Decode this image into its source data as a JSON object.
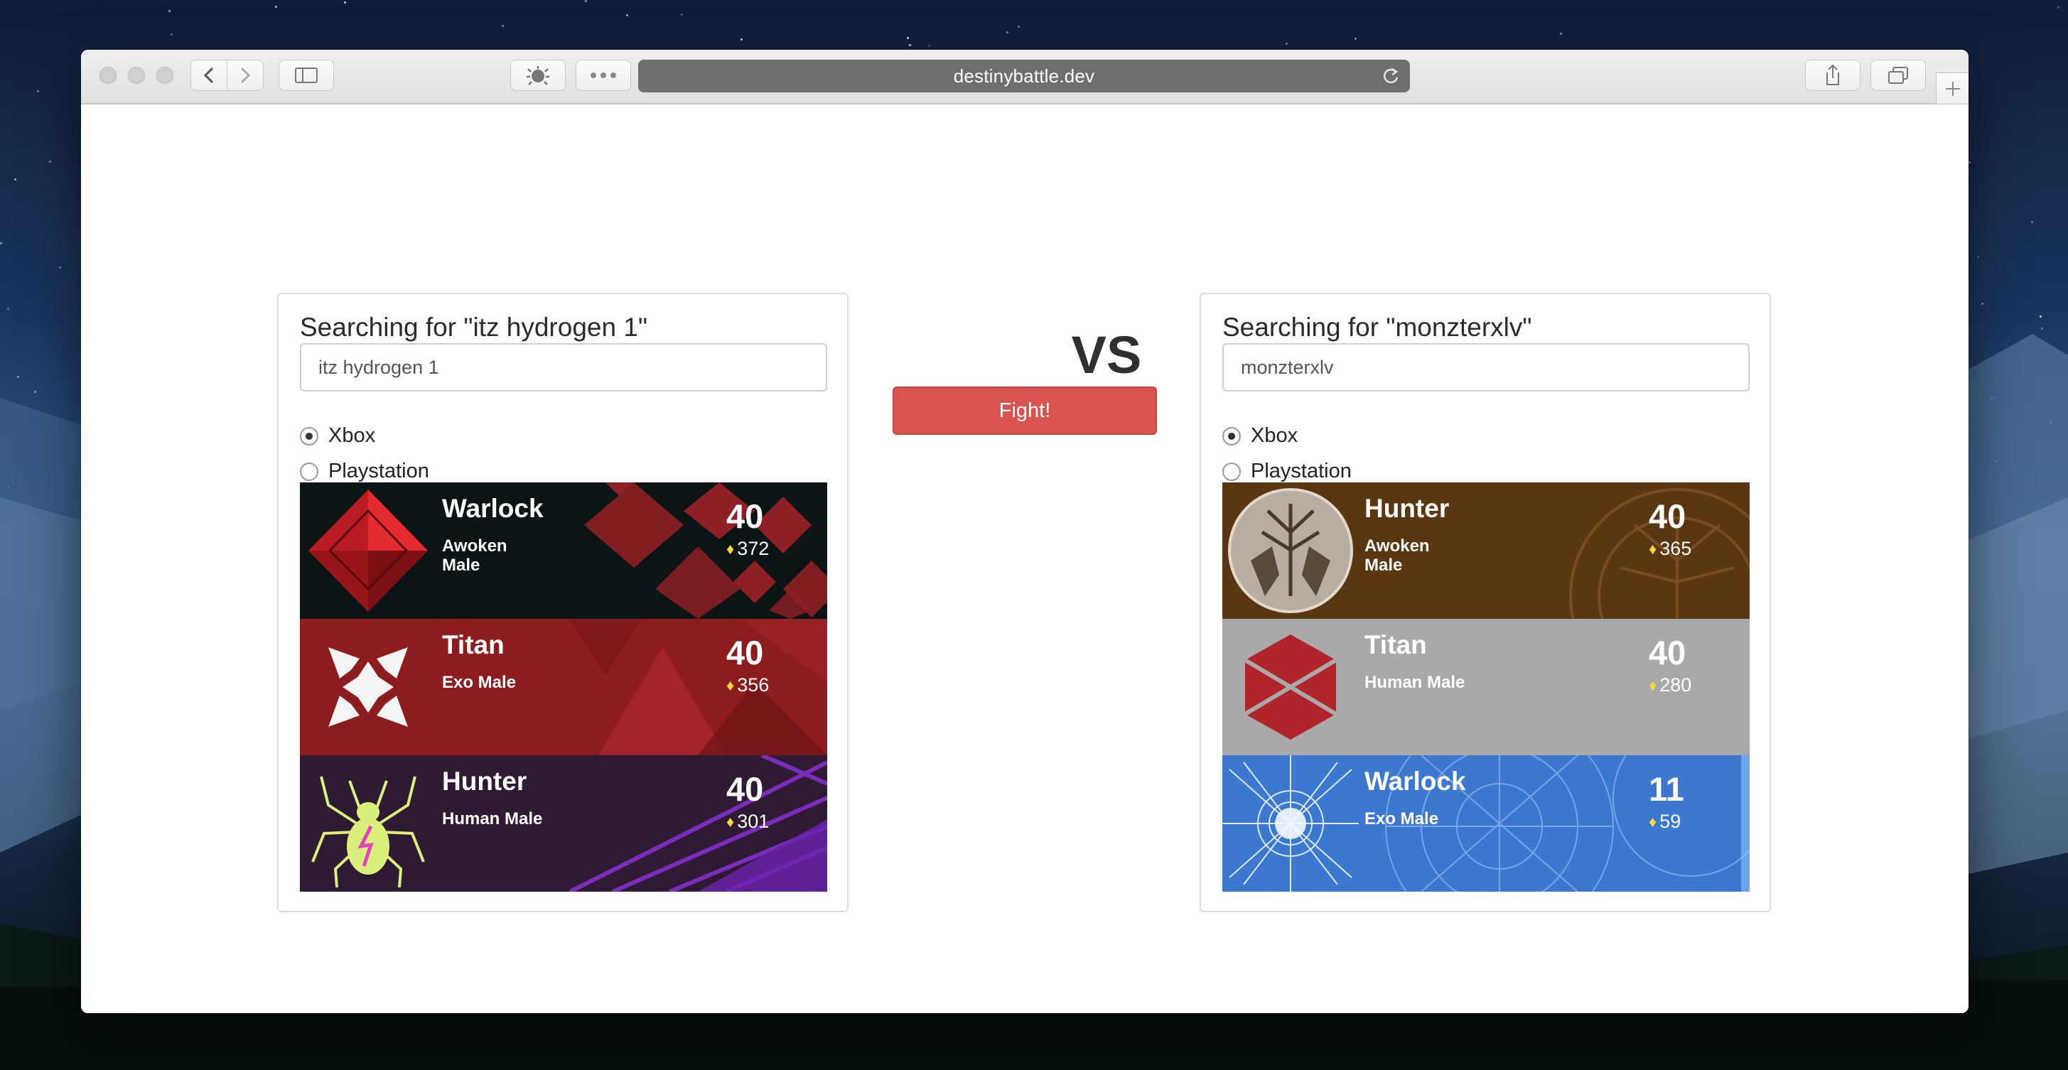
{
  "browser": {
    "url": "destinybattle.dev"
  },
  "vs_label": "VS",
  "fight_button": "Fight!",
  "players": [
    {
      "search_label": "Searching for \"itz hydrogen 1\"",
      "search_value": "itz hydrogen 1",
      "platforms": [
        {
          "label": "Xbox",
          "selected": true
        },
        {
          "label": "Playstation",
          "selected": false
        }
      ],
      "characters": [
        {
          "class": "Warlock",
          "race_line1": "Awoken",
          "race_line2": "Male",
          "level": "40",
          "light": "372",
          "emblem": "red-diamond-emblem-icon",
          "color": "#0b1515"
        },
        {
          "class": "Titan",
          "race_line1": "Exo Male",
          "race_line2": "",
          "level": "40",
          "light": "356",
          "emblem": "white-shield-emblem-icon",
          "color": "#8c1c1e"
        },
        {
          "class": "Hunter",
          "race_line1": "Human Male",
          "race_line2": "",
          "level": "40",
          "light": "301",
          "emblem": "spider-emblem-icon",
          "color": "#2e1a33"
        }
      ]
    },
    {
      "search_label": "Searching for \"monzterxlv\"",
      "search_value": "monzterxlv",
      "platforms": [
        {
          "label": "Xbox",
          "selected": true
        },
        {
          "label": "Playstation",
          "selected": false
        }
      ],
      "characters": [
        {
          "class": "Hunter",
          "race_line1": "Awoken",
          "race_line2": "Male",
          "level": "40",
          "light": "365",
          "emblem": "iron-banner-wolves-emblem-icon",
          "color": "#5a3611"
        },
        {
          "class": "Titan",
          "race_line1": "Human Male",
          "race_line2": "",
          "level": "40",
          "light": "280",
          "emblem": "red-hexagon-emblem-icon",
          "color": "#a9a9a9"
        },
        {
          "class": "Warlock",
          "race_line1": "Exo Male",
          "race_line2": "",
          "level": "11",
          "light": "59",
          "emblem": "blue-star-chart-emblem-icon",
          "color": "#3c78d0"
        }
      ]
    }
  ]
}
